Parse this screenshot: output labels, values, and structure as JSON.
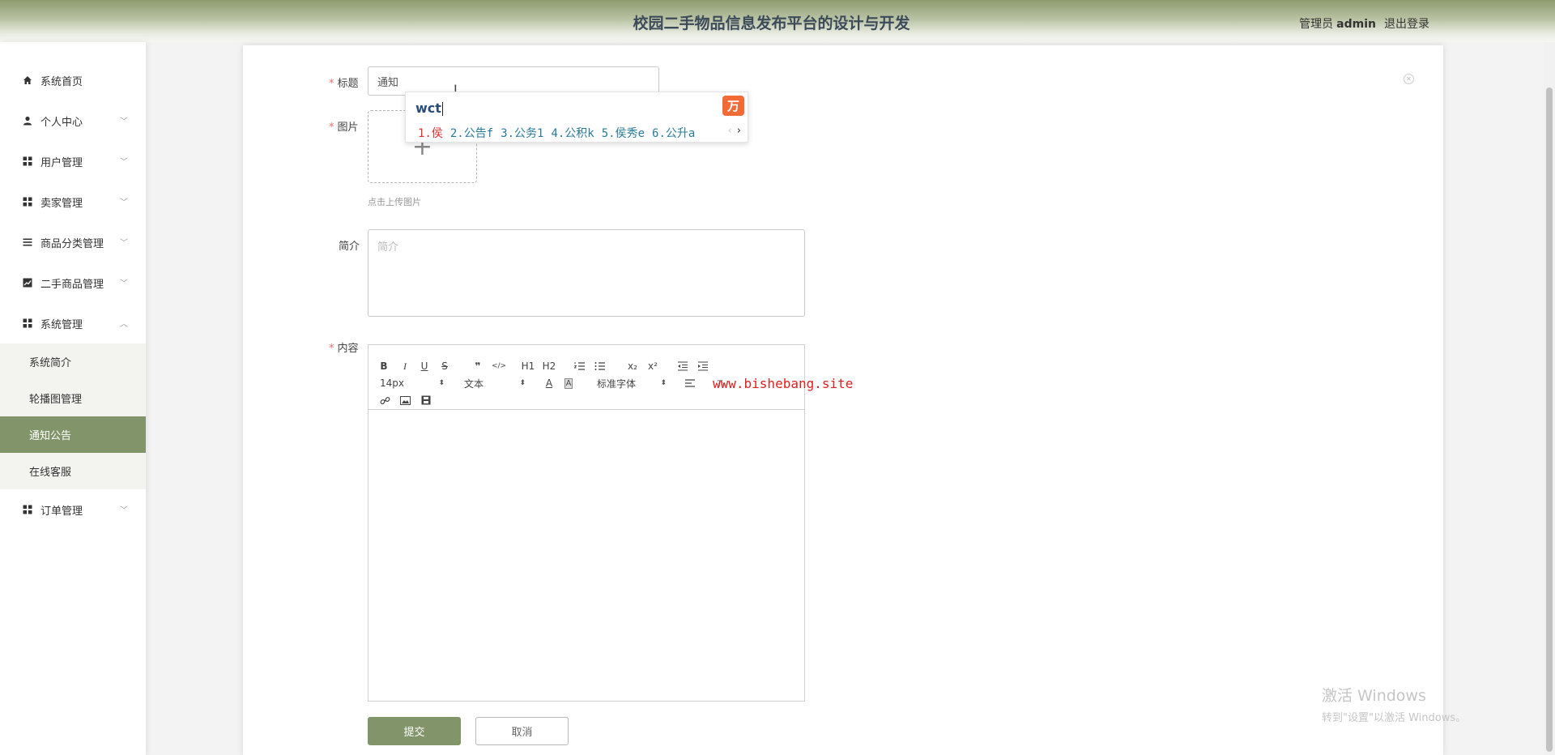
{
  "header": {
    "title": "校园二手物品信息发布平台的设计与开发",
    "role": "管理员",
    "username": "admin",
    "logout": "退出登录"
  },
  "sidebar": {
    "items": [
      {
        "label": "系统首页",
        "icon": "home-icon"
      },
      {
        "label": "个人中心",
        "icon": "user-icon"
      },
      {
        "label": "用户管理",
        "icon": "grid-icon"
      },
      {
        "label": "卖家管理",
        "icon": "grid-icon"
      },
      {
        "label": "商品分类管理",
        "icon": "list-icon"
      },
      {
        "label": "二手商品管理",
        "icon": "chart-icon"
      },
      {
        "label": "系统管理",
        "icon": "grid-icon"
      },
      {
        "label": "订单管理",
        "icon": "grid-icon"
      }
    ],
    "submenu": [
      {
        "label": "系统简介"
      },
      {
        "label": "轮播图管理"
      },
      {
        "label": "通知公告",
        "active": true
      },
      {
        "label": "在线客服"
      }
    ]
  },
  "form": {
    "title_label": "标题",
    "title_value": "通知",
    "image_label": "图片",
    "upload_plus": "+",
    "upload_hint": "点击上传图片",
    "intro_label": "简介",
    "intro_placeholder": "简介",
    "content_label": "内容",
    "required_mark": "*",
    "submit": "提交",
    "cancel": "取消"
  },
  "editor": {
    "bold": "B",
    "italic": "I",
    "underline": "U",
    "strike": "S",
    "quote": "❞",
    "code": "</>",
    "h1": "H1",
    "h2": "H2",
    "subscript": "x₂",
    "superscript": "x²",
    "font_size": "14px",
    "text_type": "文本",
    "font_family": "标准字体"
  },
  "ime": {
    "input": "wct",
    "candidates": [
      "1.侯",
      "2.公告f",
      "3.公务1",
      "4.公积k",
      "5.侯秀e",
      "6.公升a"
    ],
    "logo": "万"
  },
  "watermark": "www.bishebang.site",
  "windows_activation": {
    "line1": "激活 Windows",
    "line2": "转到\"设置\"以激活 Windows。"
  },
  "colors": {
    "accent": "#82956a",
    "header_green": "#8d9c6e",
    "required": "#f56c6c",
    "watermark": "#e0201e"
  }
}
